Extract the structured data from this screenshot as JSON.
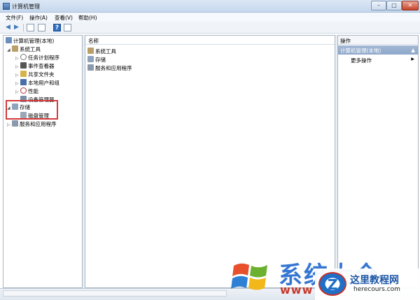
{
  "window": {
    "title": "计算机管理"
  },
  "menu": [
    "文件(F)",
    "操作(A)",
    "查看(V)",
    "帮助(H)"
  ],
  "tree": {
    "root": "计算机管理(本地)",
    "system_tools": "系统工具",
    "children": [
      "任务计划程序",
      "事件查看器",
      "共享文件夹",
      "本地用户和组",
      "性能",
      "设备管理器"
    ],
    "storage": "存储",
    "disk_mgmt": "磁盘管理",
    "services": "服务和应用程序"
  },
  "center": {
    "column_header": "名称",
    "items": [
      "系统工具",
      "存储",
      "服务和应用程序"
    ]
  },
  "actions": {
    "header": "操作",
    "selected": "计算机管理(本地)",
    "more": "更多操作"
  },
  "watermark": {
    "brand": "系统大全",
    "brand_url": "www",
    "site_name": "这里教程网",
    "site_url": "herecours.com"
  },
  "colors": {
    "highlight": "#d43a3a",
    "accent": "#2b6fd0"
  }
}
